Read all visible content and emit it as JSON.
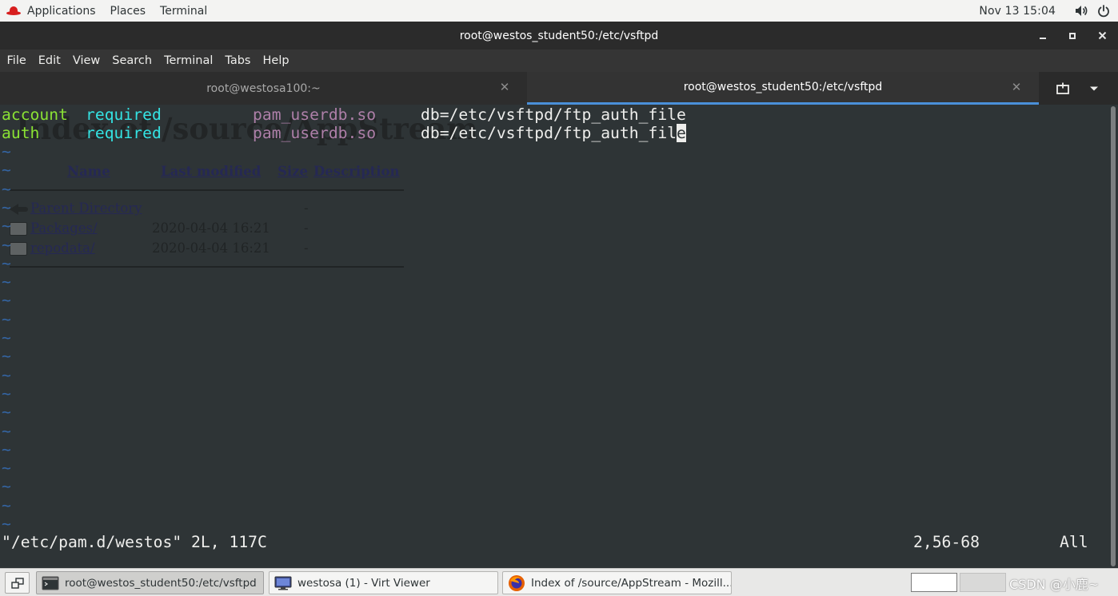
{
  "topbar": {
    "applications": "Applications",
    "places": "Places",
    "terminal": "Terminal",
    "clock": "Nov 13  15:04",
    "icons": [
      "redhat-icon",
      "volume-icon",
      "power-icon"
    ]
  },
  "window": {
    "title": "root@westos_student50:/etc/vsftpd",
    "controls": [
      "minimize-icon",
      "maximize-icon",
      "close-icon"
    ]
  },
  "menu": [
    "File",
    "Edit",
    "View",
    "Search",
    "Terminal",
    "Tabs",
    "Help"
  ],
  "tabs": [
    {
      "label": "root@westosa100:~",
      "active": false
    },
    {
      "label": "root@westos_student50:/etc/vsftpd",
      "active": true
    }
  ],
  "tab_tools": [
    "new-tab-icon",
    "tab-menu-chevron-icon"
  ],
  "editor": {
    "lines": [
      {
        "type": "account",
        "control": "required",
        "module": "pam_userdb.so",
        "args": "db=/etc/vsftpd/ftp_auth_file"
      },
      {
        "type": "auth",
        "control": "required",
        "module": "pam_userdb.so",
        "args_before_cursor": "db=/etc/vsftpd/ftp_auth_fil",
        "cursor_char": "e"
      }
    ],
    "tilde": "~",
    "status_file": "\"/etc/pam.d/westos\" 2L, 117C",
    "status_pos": "2,56-68",
    "status_view": "All",
    "colors": {
      "background": "#2e3436",
      "green": "#8ae234",
      "cyan": "#34e2e2",
      "magenta": "#ad7fa8",
      "tilde": "#3465a4"
    }
  },
  "ghost_page": {
    "title": "Index of /source/AppStream",
    "headers": {
      "name": "Name",
      "modified": "Last modified",
      "size": "Size",
      "description": "Description"
    },
    "rows": [
      {
        "name": "Parent Directory",
        "date": "",
        "size": "-"
      },
      {
        "name": "Packages/",
        "date": "2020-04-04 16:21",
        "size": "-"
      },
      {
        "name": "repodata/",
        "date": "2020-04-04 16:21",
        "size": "-"
      }
    ]
  },
  "taskbar": {
    "tasks": [
      {
        "label": "root@westos_student50:/etc/vsftpd",
        "icon": "terminal-icon",
        "active": true
      },
      {
        "label": "westosa (1) - Virt Viewer",
        "icon": "virt-viewer-icon",
        "active": false
      },
      {
        "label": "Index of /source/AppStream - Mozill...",
        "icon": "firefox-icon",
        "active": false
      }
    ],
    "watermark": "CSDN @小鹿~"
  }
}
